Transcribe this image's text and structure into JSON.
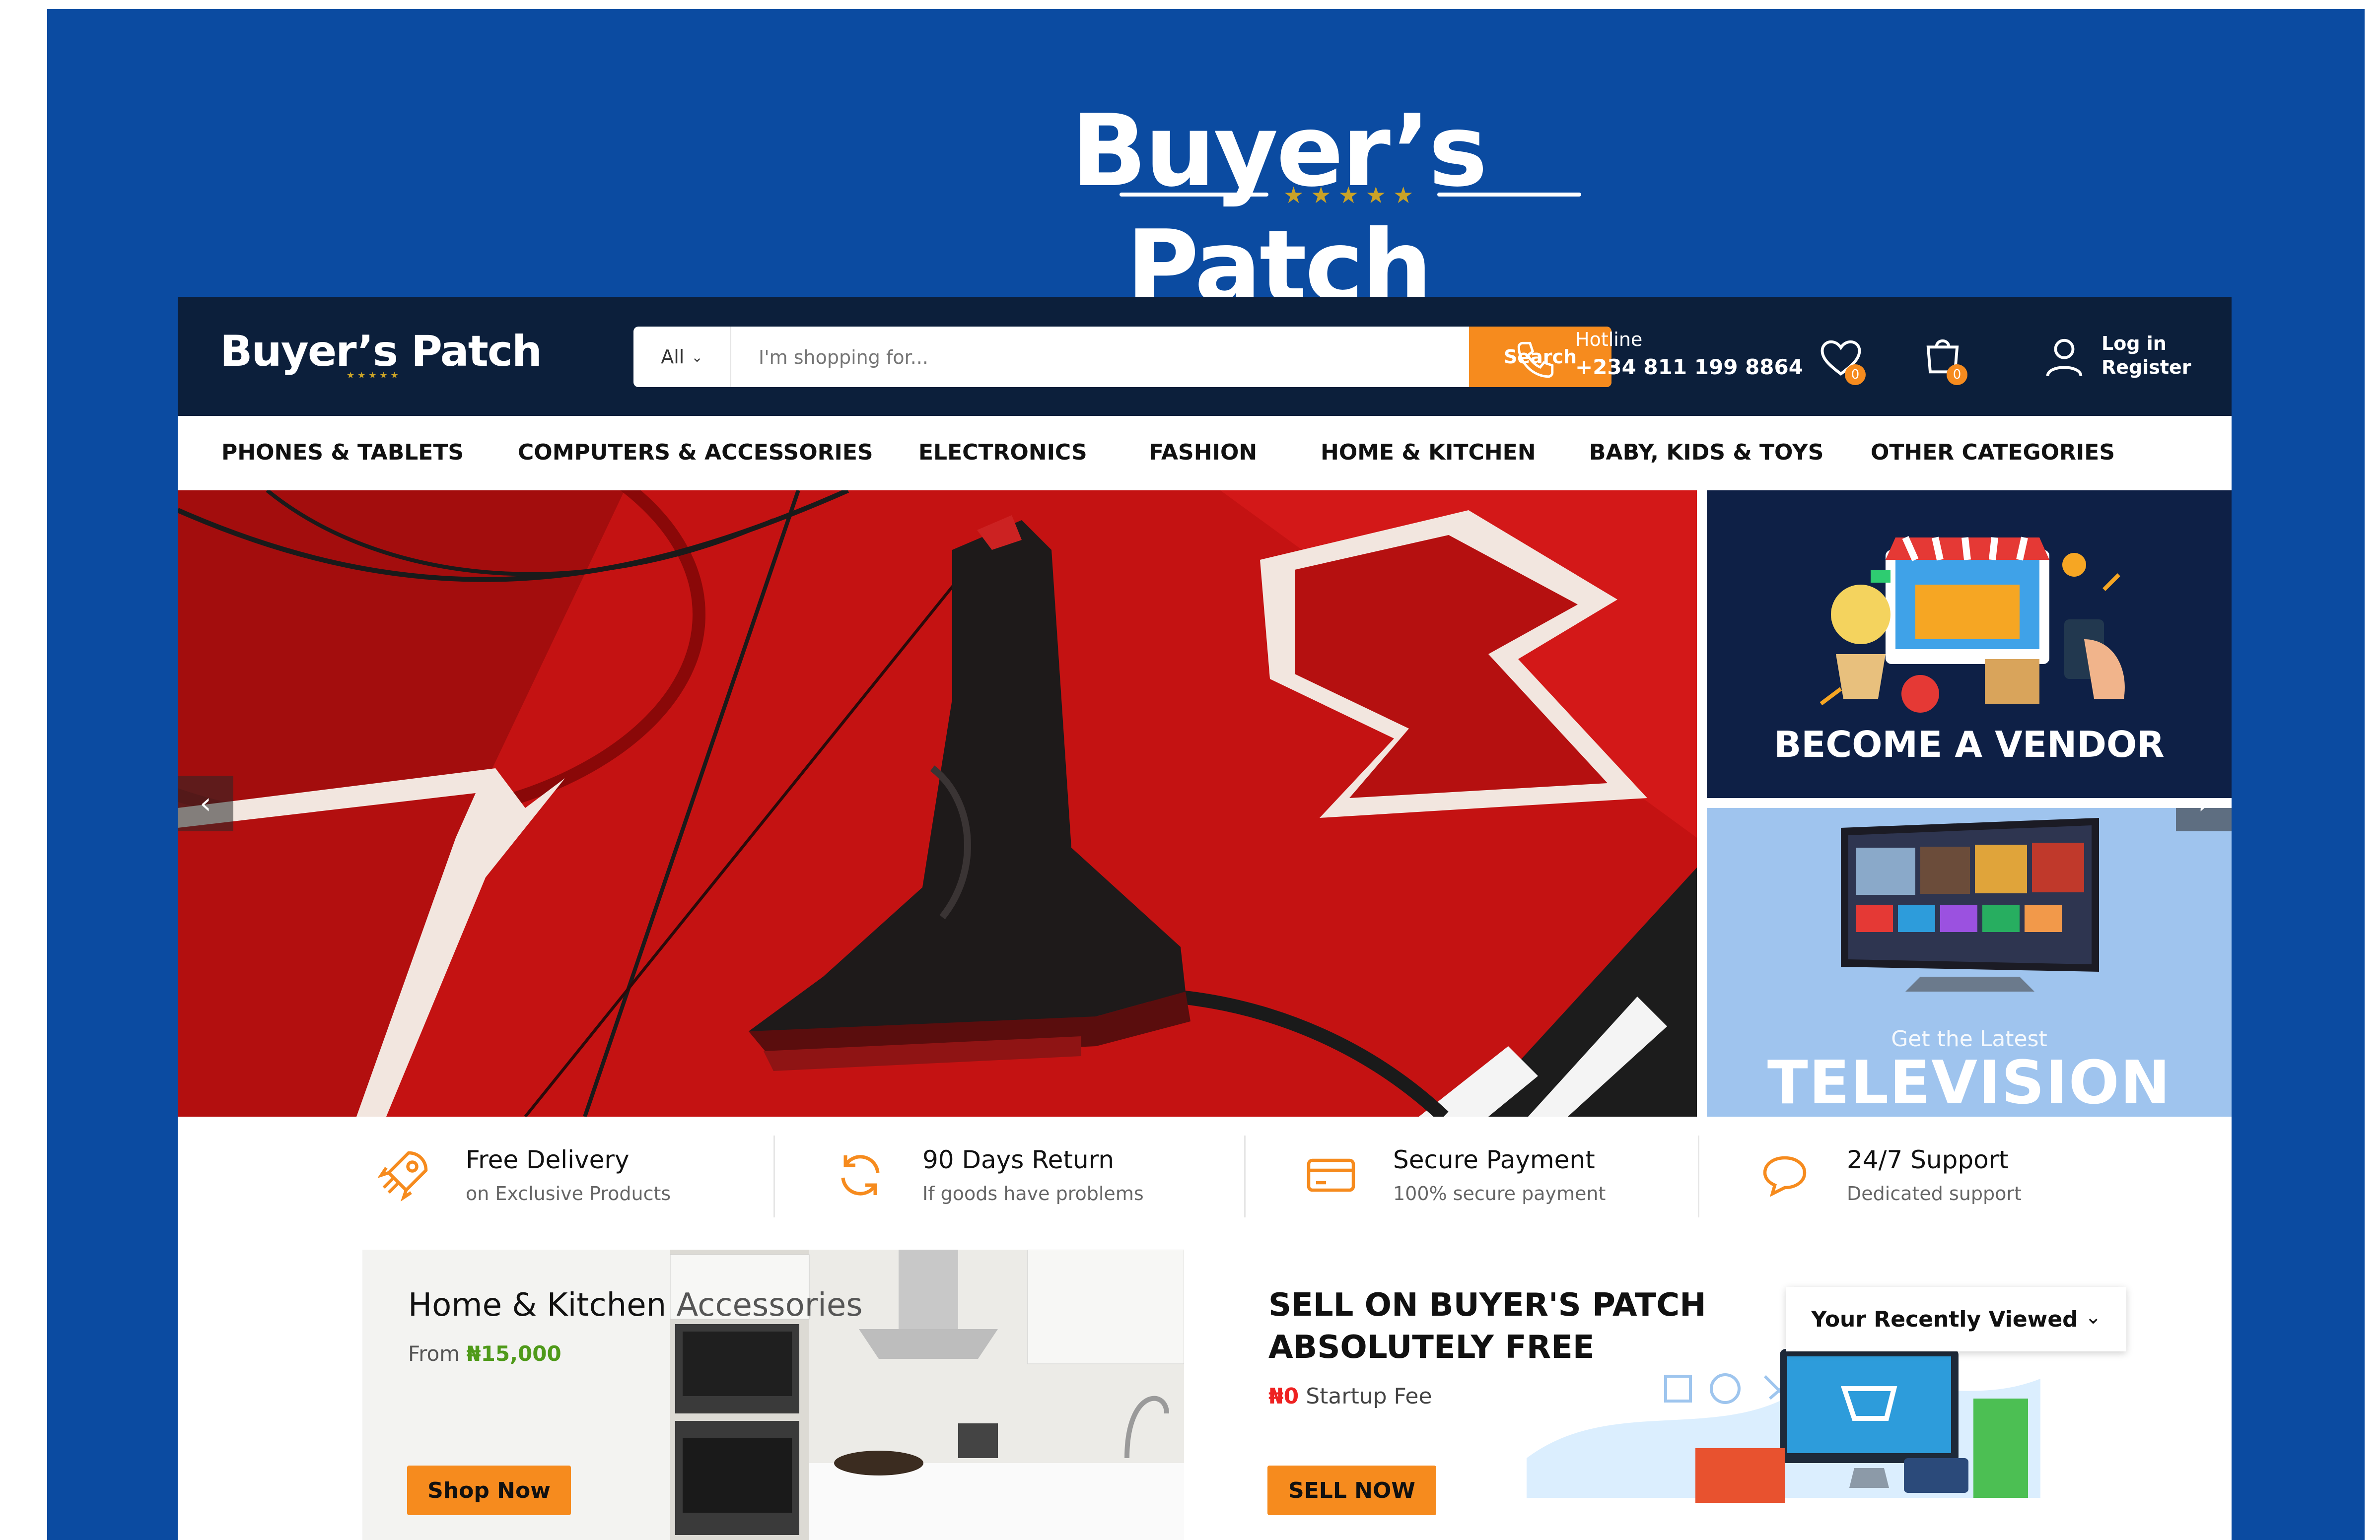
{
  "banner": {
    "brand": "Buyer’s Patch",
    "stars": "★★★★★"
  },
  "header": {
    "logo": "Buyer’s Patch",
    "search": {
      "category": "All",
      "placeholder": "I'm shopping for...",
      "button": "Search"
    },
    "hotline": {
      "label": "Hotline",
      "number": "+234 811 199 8864"
    },
    "wishlist_count": "0",
    "cart_count": "0",
    "account": {
      "login": "Log in",
      "register": "Register"
    }
  },
  "nav": {
    "items": [
      "PHONES & TABLETS",
      "COMPUTERS & ACCESSORIES",
      "ELECTRONICS",
      "FASHION",
      "HOME & KITCHEN",
      "BABY, KIDS & TOYS",
      "OTHER CATEGORIES"
    ]
  },
  "hero": {
    "prev": "‹",
    "next": "›"
  },
  "side_banners": {
    "vendor": "BECOME A VENDOR",
    "tv_small": "Get the Latest",
    "tv_big": "TELEVISION"
  },
  "features": [
    {
      "icon": "rocket-icon",
      "title": "Free Delivery",
      "subtitle": "on Exclusive Products"
    },
    {
      "icon": "refresh-icon",
      "title": "90 Days Return",
      "subtitle": "If goods have problems"
    },
    {
      "icon": "credit-card-icon",
      "title": "Secure Payment",
      "subtitle": "100% secure payment"
    },
    {
      "icon": "chat-icon",
      "title": "24/7 Support",
      "subtitle": "Dedicated support"
    }
  ],
  "promo_home": {
    "title_main": "Home & Kitchen ",
    "title_rest": "Accessories",
    "from_label": "From ",
    "price": "₦15,000",
    "button": "Shop Now"
  },
  "promo_sell": {
    "line1": "SELL ON BUYER'S PATCH",
    "line2": "ABSOLUTELY FREE",
    "fee_amount": "₦0",
    "fee_label": " Startup Fee",
    "button": "SELL NOW"
  },
  "recently_viewed": "Your Recently Viewed",
  "colors": {
    "frame": "#0b4ba1",
    "topbar": "#0c1f3b",
    "accent": "#f68b1e",
    "hero": "#b80f0f",
    "vendor": "#0e2046",
    "tv": "#9fc4ee"
  }
}
